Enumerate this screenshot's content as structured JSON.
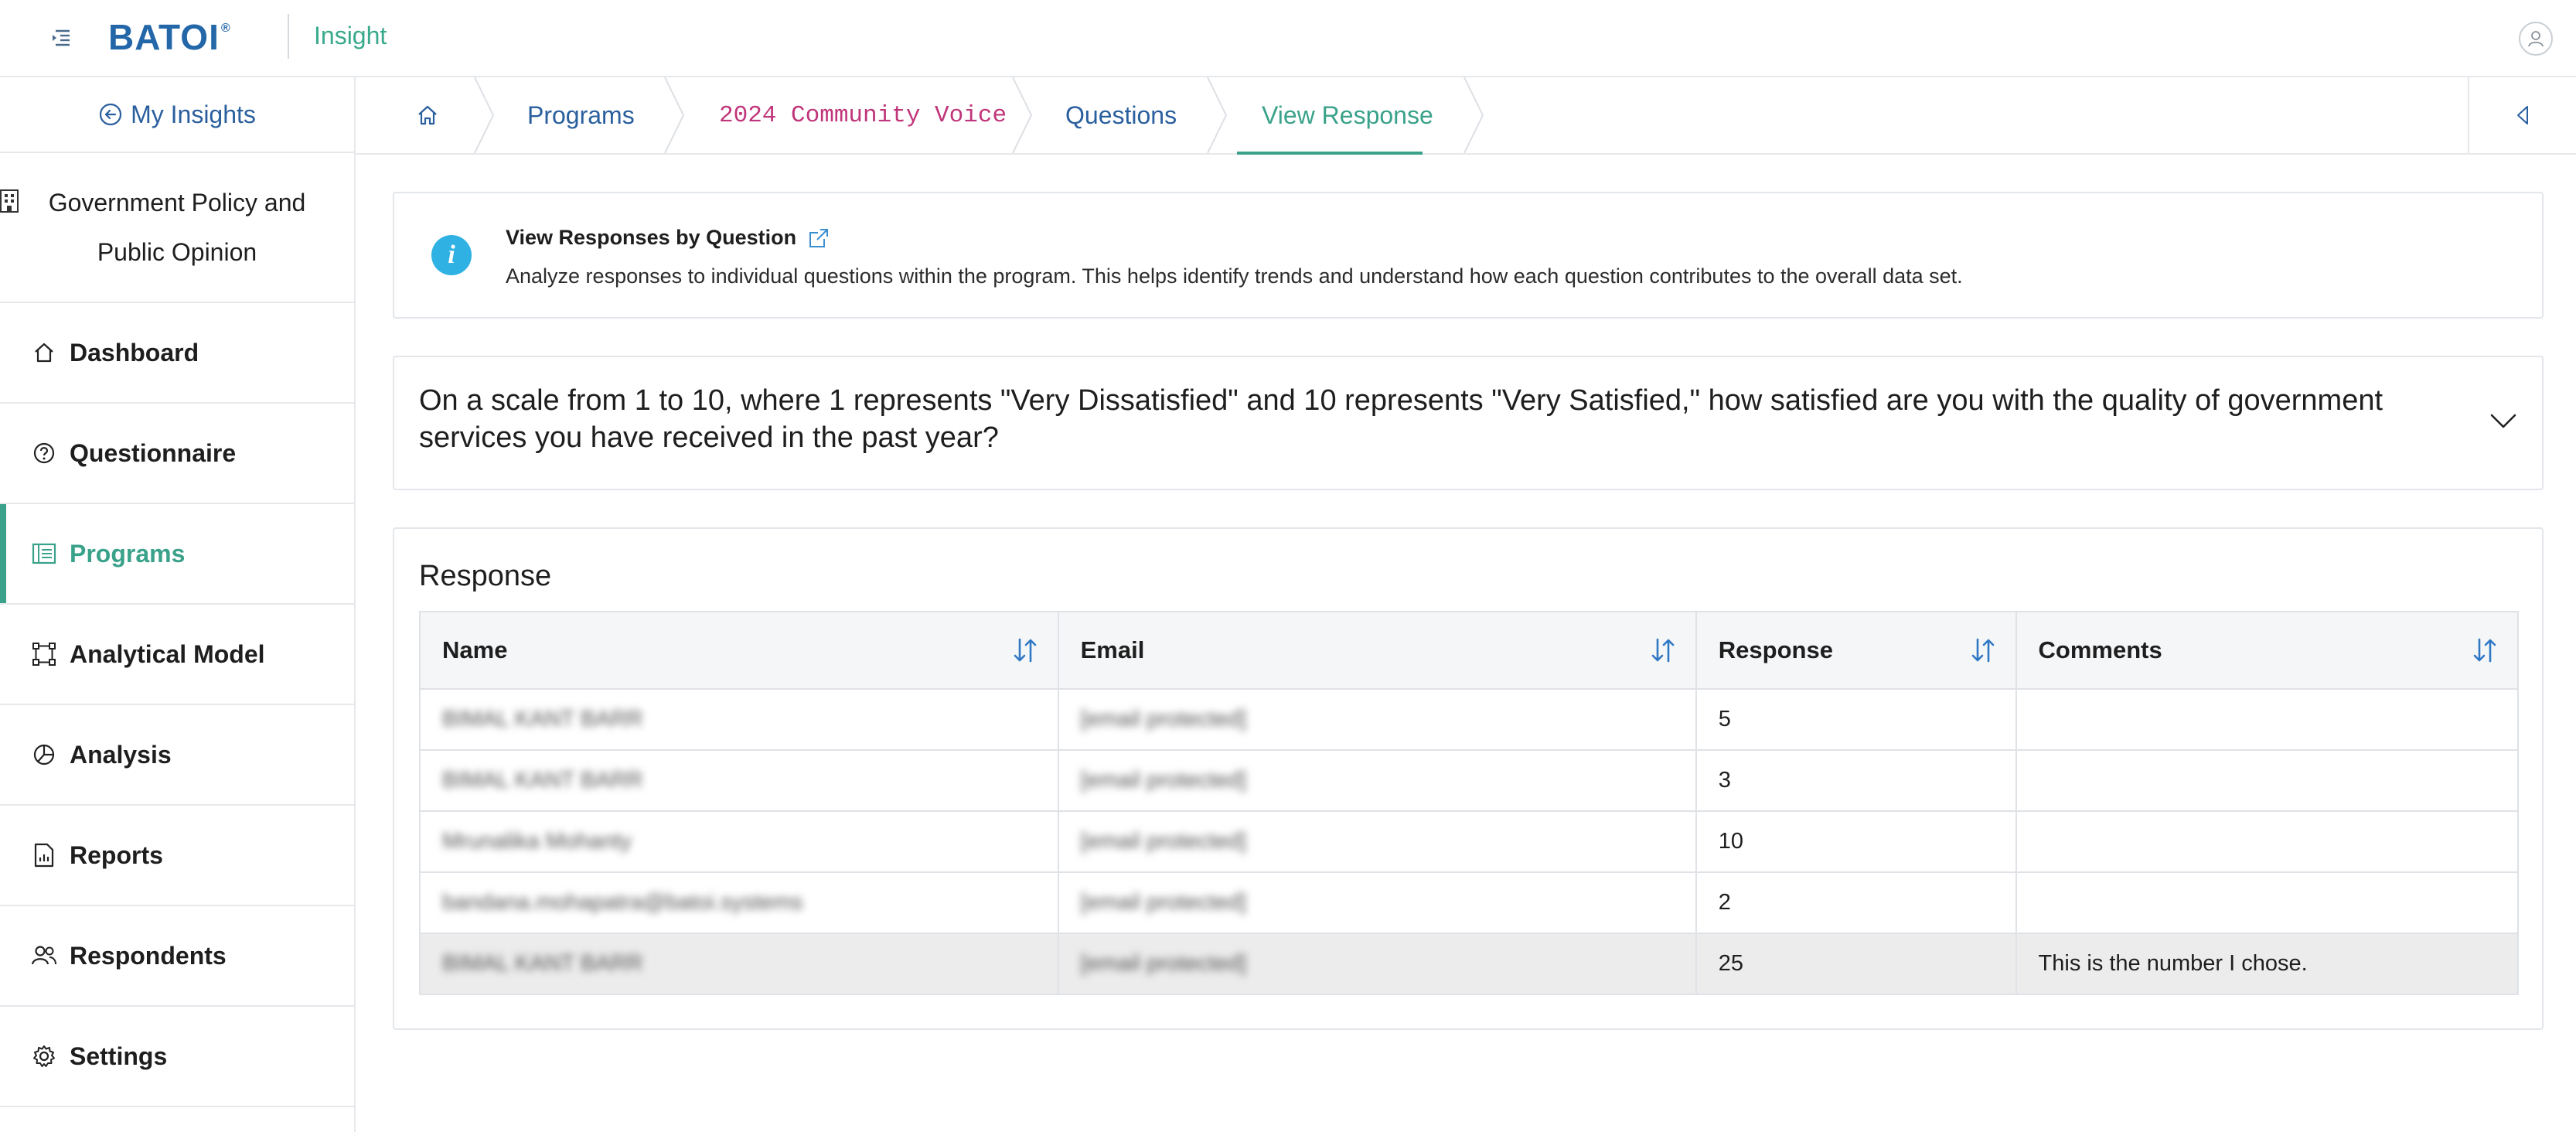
{
  "header": {
    "logo_text": "BATOI",
    "logo_reg": "®",
    "app_name": "Insight",
    "menu_icon": "menu-collapse-icon",
    "user_icon": "user-icon"
  },
  "sidebar": {
    "back_label": "My Insights",
    "org_name": "Government Policy and Public Opinion",
    "items": [
      {
        "label": "Dashboard",
        "icon": "home-icon"
      },
      {
        "label": "Questionnaire",
        "icon": "question-circle-icon"
      },
      {
        "label": "Programs",
        "icon": "list-icon"
      },
      {
        "label": "Analytical Model",
        "icon": "model-icon"
      },
      {
        "label": "Analysis",
        "icon": "pie-chart-icon"
      },
      {
        "label": "Reports",
        "icon": "report-icon"
      },
      {
        "label": "Respondents",
        "icon": "users-icon"
      },
      {
        "label": "Settings",
        "icon": "gear-icon"
      }
    ],
    "active_item": "Programs"
  },
  "breadcrumb": {
    "items": [
      "Programs",
      "2024 Community Voice",
      "Questions",
      "View Response"
    ],
    "active": "View Response"
  },
  "info": {
    "title": "View Responses by Question",
    "description": "Analyze responses to individual questions within the program. This helps identify trends and understand how each question contributes to the overall data set."
  },
  "question": {
    "text": "On a scale from 1 to 10, where 1 represents \"Very Dissatisfied\" and 10 represents \"Very Satisfied,\" how satisfied are you with the quality of government services you have received in the past year?"
  },
  "response": {
    "title": "Response",
    "columns": [
      "Name",
      "Email",
      "Response",
      "Comments"
    ],
    "rows": [
      {
        "name": "BIMAL KANT BARR",
        "email": "[email protected]",
        "response": "5",
        "comments": ""
      },
      {
        "name": "BIMAL KANT BARR",
        "email": "[email protected]",
        "response": "3",
        "comments": ""
      },
      {
        "name": "Mrunalika Mohanty",
        "email": "[email protected]",
        "response": "10",
        "comments": ""
      },
      {
        "name": "bandana.mohapatra@batoi.systems",
        "email": "[email protected]",
        "response": "2",
        "comments": ""
      },
      {
        "name": "BIMAL KANT BARR",
        "email": "[email protected]",
        "response": "25",
        "comments": "This is the number I chose."
      }
    ]
  },
  "colors": {
    "accent_green": "#3aa28a",
    "link_blue": "#2a5f9e",
    "code_pink": "#c0357a",
    "info_blue": "#2fb1e3"
  }
}
